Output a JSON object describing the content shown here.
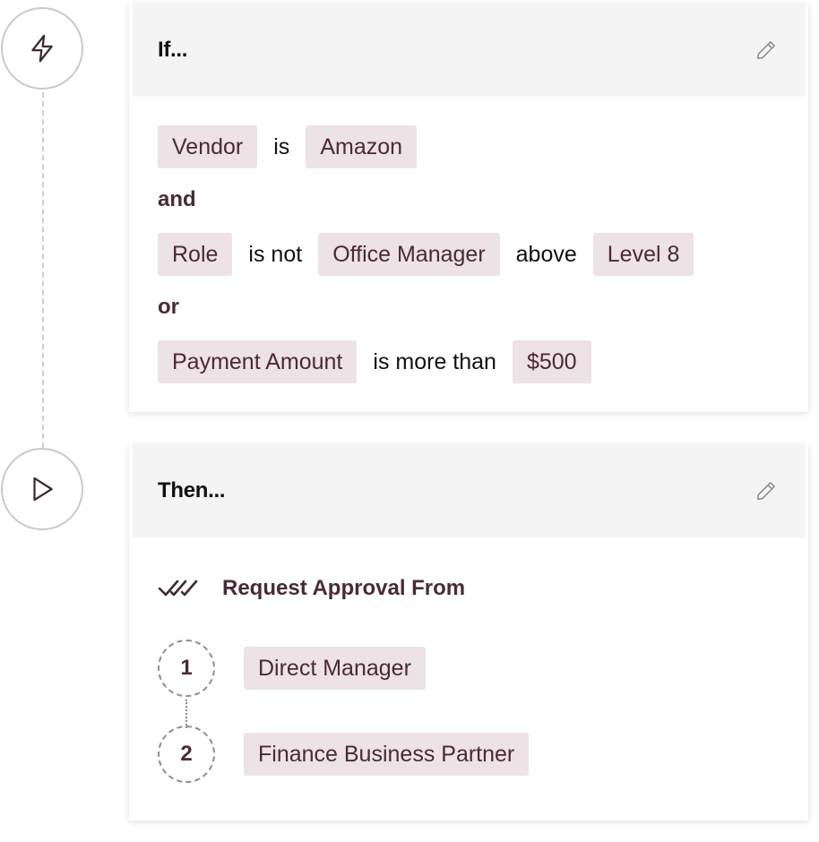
{
  "trigger": {
    "title": "If...",
    "icon": "lightning-icon",
    "rows": [
      {
        "parts": [
          {
            "type": "chip",
            "text": "Vendor"
          },
          {
            "type": "op",
            "text": "is"
          },
          {
            "type": "chip",
            "text": "Amazon"
          }
        ]
      },
      {
        "parts": [
          {
            "type": "chip",
            "text": "Role"
          },
          {
            "type": "op",
            "text": "is not"
          },
          {
            "type": "chip",
            "text": "Office Manager"
          },
          {
            "type": "op",
            "text": "above"
          },
          {
            "type": "chip",
            "text": "Level 8"
          }
        ]
      },
      {
        "parts": [
          {
            "type": "chip",
            "text": "Payment Amount"
          },
          {
            "type": "op",
            "text": "is more than"
          },
          {
            "type": "chip",
            "text": "$500"
          }
        ]
      }
    ],
    "connectors": [
      "and",
      "or"
    ]
  },
  "action": {
    "title": "Then...",
    "icon": "play-icon",
    "action_label": "Request Approval From",
    "action_icon": "double-check-icon",
    "steps": [
      {
        "number": "1",
        "approver": "Direct Manager"
      },
      {
        "number": "2",
        "approver": "Finance Business Partner"
      }
    ]
  },
  "colors": {
    "chip_bg": "#ede2e5",
    "chip_text": "#4a2a35",
    "header_bg": "#f4f4f4"
  }
}
